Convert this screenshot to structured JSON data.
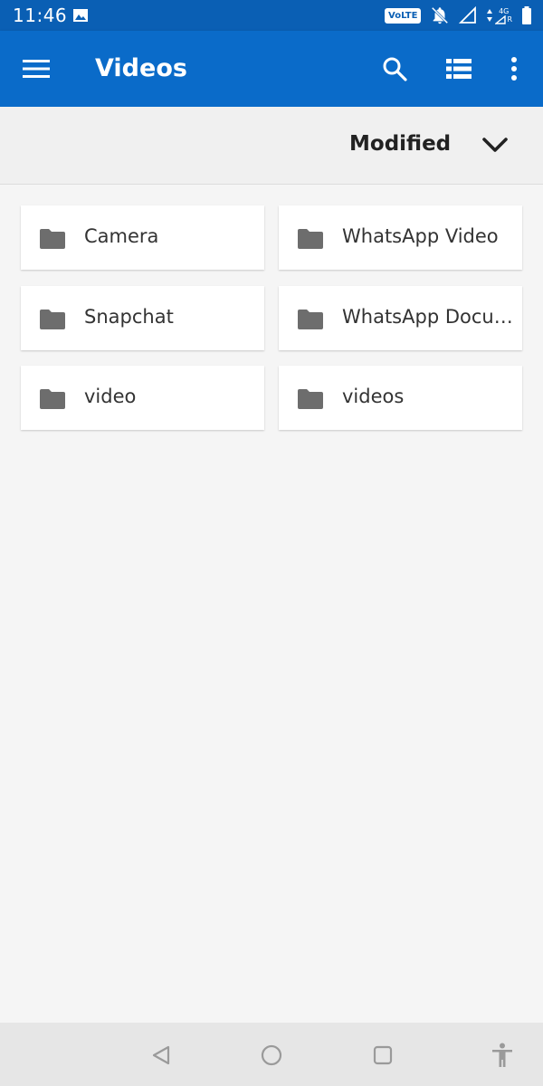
{
  "status": {
    "time": "11:46",
    "volte": "VoLTE",
    "network": "4G",
    "network_sub": "R"
  },
  "header": {
    "title": "Videos"
  },
  "sort": {
    "label": "Modified"
  },
  "folders": [
    {
      "name": "Camera"
    },
    {
      "name": "WhatsApp Video"
    },
    {
      "name": "Snapchat"
    },
    {
      "name": "WhatsApp Documents"
    },
    {
      "name": "video"
    },
    {
      "name": "videos"
    }
  ],
  "colors": {
    "status_bar": "#0a5fb4",
    "app_bar": "#0a6bc9",
    "folder_icon": "#6d6d6d",
    "background": "#f5f5f5"
  },
  "icons": {
    "menu": "hamburger-menu-icon",
    "search": "search-icon",
    "view": "list-view-icon",
    "more": "more-vert-icon",
    "folder": "folder-icon",
    "sort": "chevron-down-icon"
  }
}
